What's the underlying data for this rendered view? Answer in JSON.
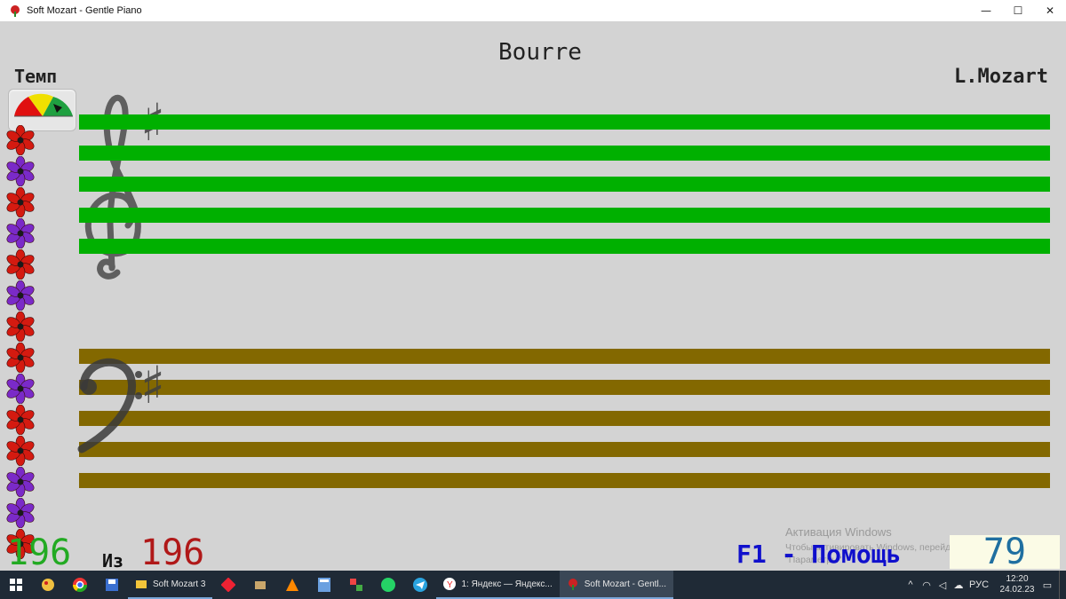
{
  "window": {
    "title": "Soft Mozart - Gentle Piano",
    "controls": {
      "minimize": "—",
      "maximize": "☐",
      "close": "✕"
    }
  },
  "score": {
    "title": "Bourre",
    "composer": "L.Mozart",
    "tempo_label": "Темп",
    "current_note": "196",
    "of_label": "Из",
    "total_notes": "196",
    "help_label": "F1 - Помощь",
    "score_value": "79"
  },
  "colors": {
    "treble_staff": "#00b000",
    "bass_staff": "#836800",
    "current_note": "#22aa22",
    "total_notes": "#b01818",
    "help": "#1010cc",
    "score": "#1f6fa0"
  },
  "staffs": {
    "treble": {
      "clef": "treble-clef",
      "key_signature": "♯",
      "lines": 5
    },
    "bass": {
      "clef": "bass-clef",
      "key_signature": "♯",
      "lines": 5
    }
  },
  "flowers": [
    "red",
    "purple",
    "red",
    "purple",
    "red",
    "purple",
    "red",
    "red",
    "purple",
    "red",
    "red",
    "purple",
    "purple",
    "red"
  ],
  "activation": {
    "line1": "Активация Windows",
    "line2": "Чтобы активировать Windows, перейдите в раздел",
    "line3": "\"Параметры\"."
  },
  "taskbar": {
    "apps": [
      {
        "name": "Soft Mozart 3",
        "icon": "folder-icon"
      },
      {
        "name": "1: Яндекс — Яндекс...",
        "icon": "yandex-icon"
      },
      {
        "name": "Soft Mozart - Gentl...",
        "icon": "soft-mozart-icon"
      }
    ],
    "tray": {
      "language": "РУС",
      "time": "12:20",
      "date": "24.02.23"
    }
  }
}
